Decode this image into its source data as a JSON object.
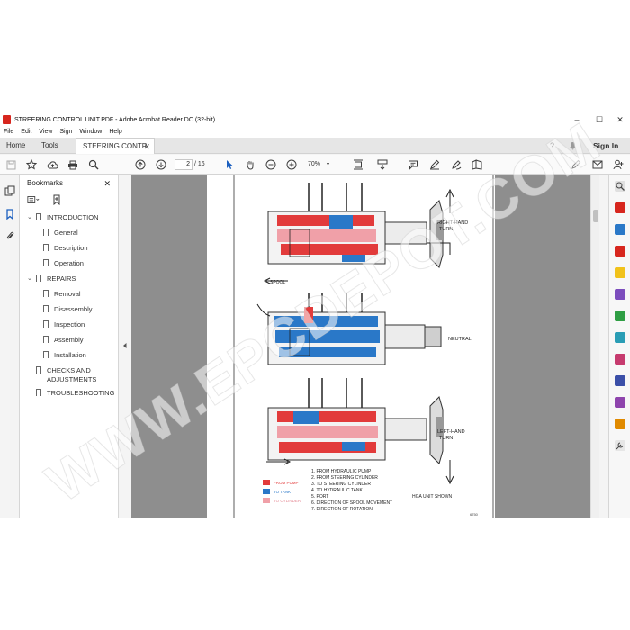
{
  "window": {
    "title": "STREERING CONTROL UNIT.PDF - Adobe Acrobat Reader DC (32-bit)",
    "minimize": "–",
    "maximize": "☐",
    "close": "✕"
  },
  "menu": [
    "File",
    "Edit",
    "View",
    "Sign",
    "Window",
    "Help"
  ],
  "tabs": {
    "home": "Home",
    "tools": "Tools",
    "doc": "STEERING CONTR...",
    "doc_close": "✕"
  },
  "header_right": {
    "help": "?",
    "bell": "🔔",
    "signin": "Sign In"
  },
  "toolbar": {
    "page_current": "2",
    "page_total": "/ 16",
    "zoom": "70%"
  },
  "panel": {
    "title": "Bookmarks",
    "close": "✕",
    "items": [
      {
        "label": "INTRODUCTION",
        "level": 0,
        "expanded": true
      },
      {
        "label": "General",
        "level": 1
      },
      {
        "label": "Description",
        "level": 1
      },
      {
        "label": "Operation",
        "level": 1
      },
      {
        "label": "REPAIRS",
        "level": 0,
        "expanded": true
      },
      {
        "label": "Removal",
        "level": 1
      },
      {
        "label": "Disassembly",
        "level": 1
      },
      {
        "label": "Inspection",
        "level": 1
      },
      {
        "label": "Assembly",
        "level": 1
      },
      {
        "label": "Installation",
        "level": 1
      },
      {
        "label": "CHECKS AND",
        "label2": "ADJUSTMENTS",
        "level": 0
      },
      {
        "label": "TROUBLESHOOTING",
        "level": 0
      }
    ]
  },
  "diagram": {
    "label_right_turn": "RIGHT-HAND",
    "label_right_turn2": "TURN",
    "label_neutral": "NEUTRAL",
    "label_left_turn": "LEFT-HAND",
    "label_left_turn2": "TURN",
    "spool_label": "SPOOL",
    "legend": [
      {
        "label": "FROM PUMP",
        "color": "#e23b3b"
      },
      {
        "label": "TO TANK",
        "color": "#2a78c8"
      },
      {
        "label": "TO CYLINDER",
        "color": "#f0a0a8"
      }
    ],
    "key": [
      "1. FROM HYDRAULIC PUMP",
      "2. FROM STEERING CYLINDER",
      "3. TO STEERING CYLINDER",
      "4. TO HYDRAULIC TANK",
      "5. PORT",
      "6. DIRECTION OF SPOOL MOVEMENT",
      "7. DIRECTION OF ROTATION"
    ],
    "note": "HGA UNIT SHOWN",
    "fig_no": "6750"
  },
  "watermark": "WWW.EPCDEPOT.COM",
  "colors": {
    "pump": "#e23b3b",
    "tank": "#2a78c8",
    "cylinder": "#f0a0a8",
    "acrobat_red": "#d7261e"
  }
}
